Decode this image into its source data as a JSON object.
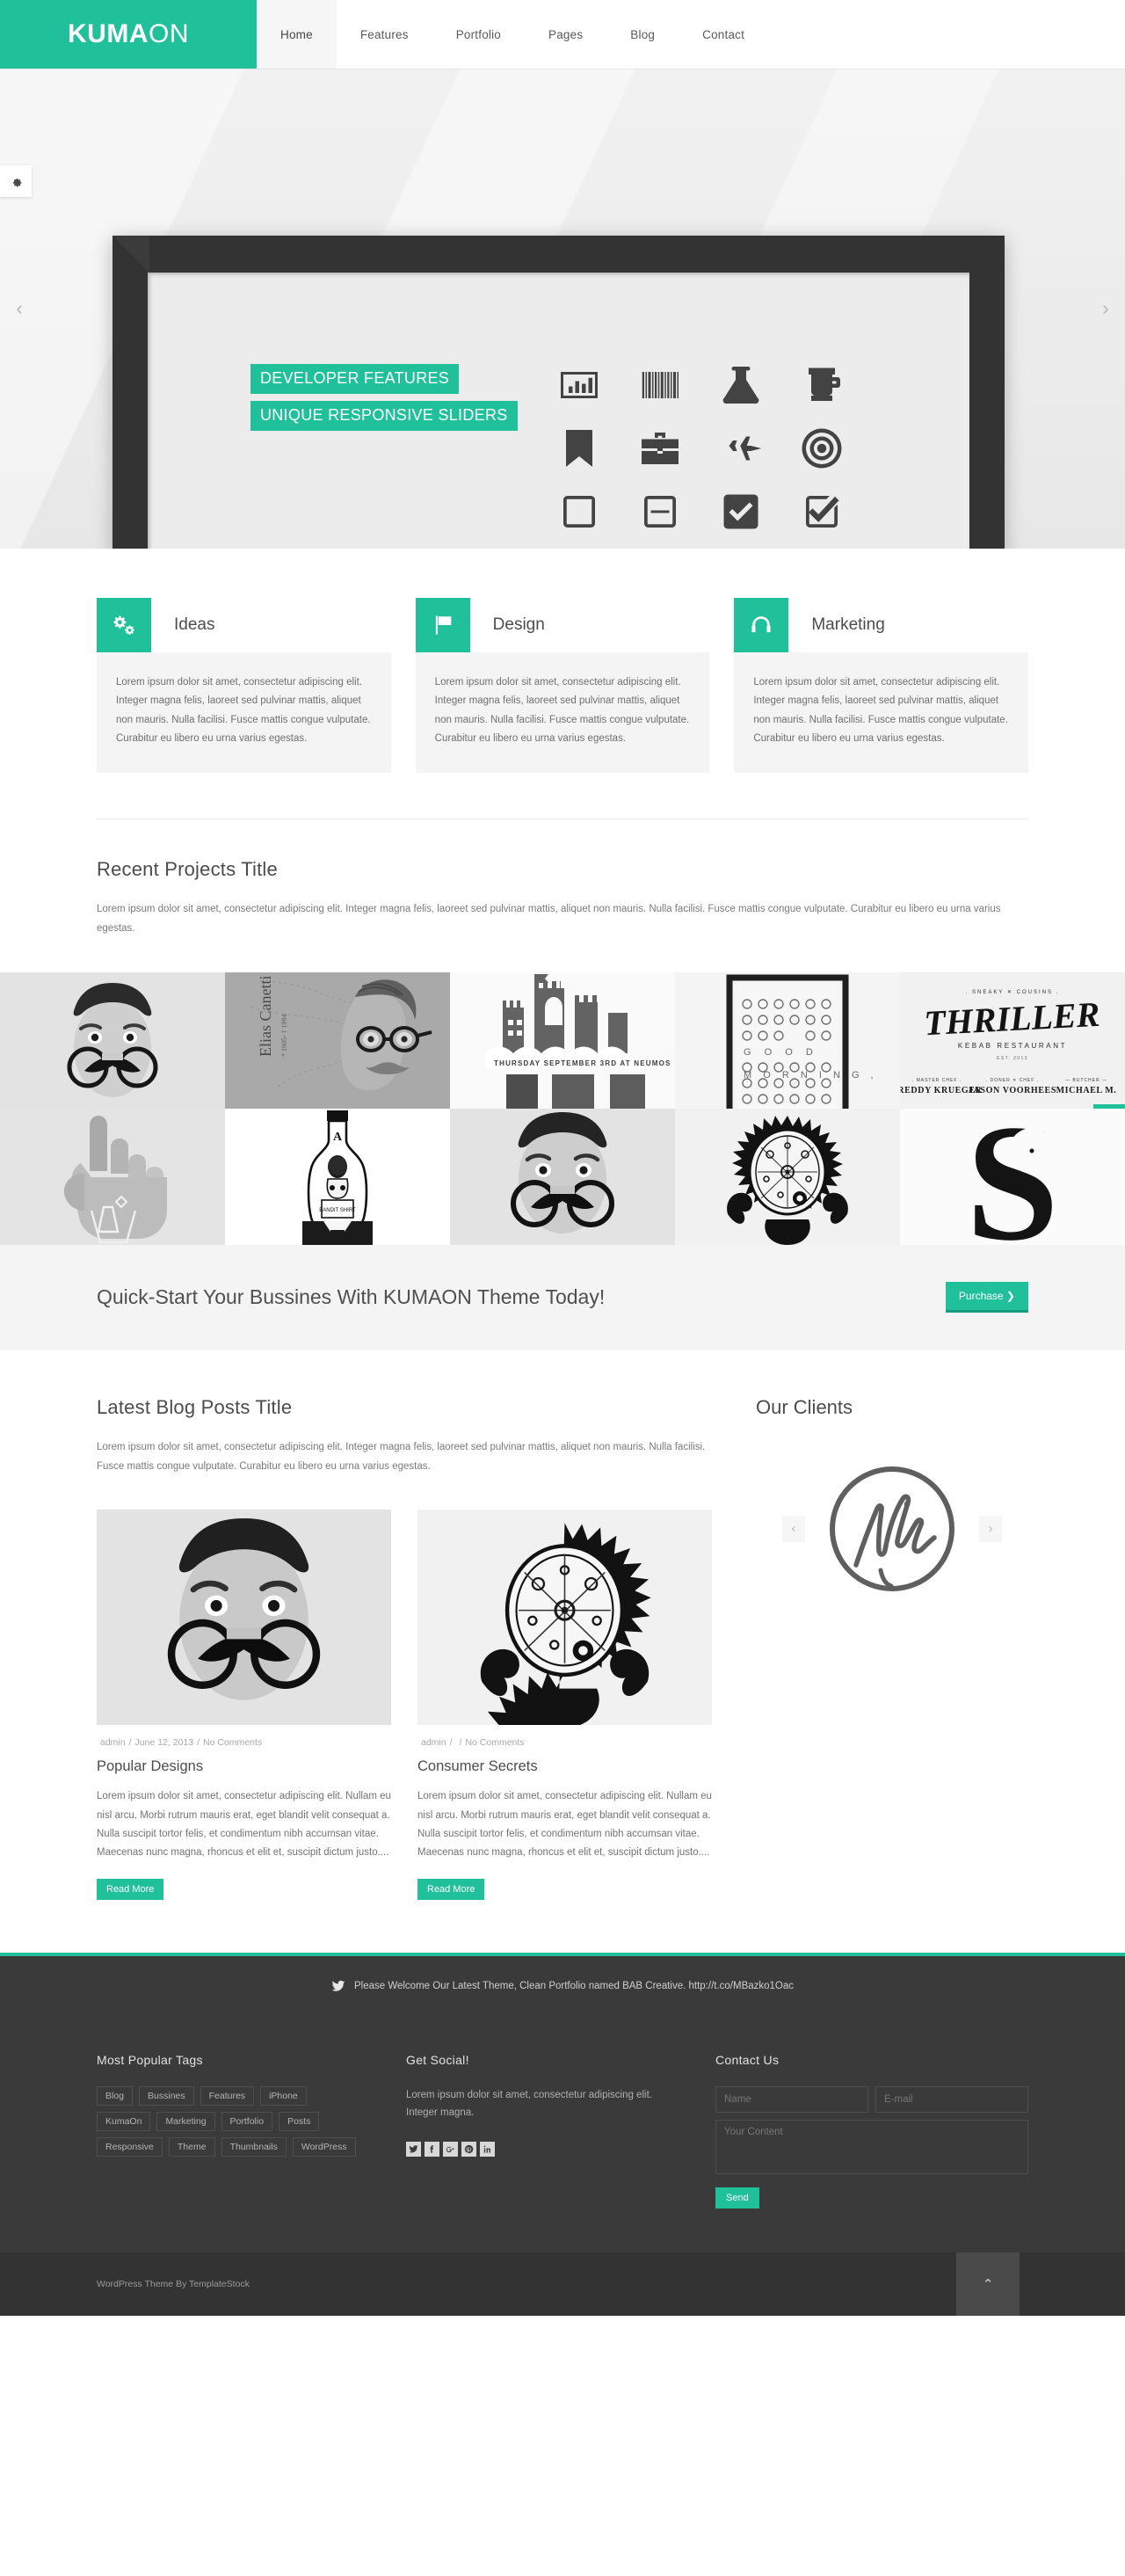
{
  "colors": {
    "accent": "#20c09b",
    "accent_dark": "#169b7c",
    "dark": "#3a3a3a",
    "frame": "#333333"
  },
  "header": {
    "brand_bold": "KUMA",
    "brand_light": "ON",
    "nav": [
      {
        "label": "Home",
        "active": true
      },
      {
        "label": "Features",
        "active": false
      },
      {
        "label": "Portfolio",
        "active": false
      },
      {
        "label": "Pages",
        "active": false
      },
      {
        "label": "Blog",
        "active": false
      },
      {
        "label": "Contact",
        "active": false
      }
    ]
  },
  "slider": {
    "settings_icon": "gear-icon",
    "prev_arrow": "‹",
    "next_arrow": "›",
    "tag_line_1": "DEVELOPER FEATURES",
    "tag_line_2": "UNIQUE RESPONSIVE SLIDERS",
    "icons": [
      "bar-chart-icon",
      "barcode-icon",
      "flask-icon",
      "blender-icon",
      "bookmark-icon",
      "briefcase-icon",
      "jet-icon",
      "bullseye-icon",
      "square-icon",
      "minus-square-icon",
      "check-square-filled-icon",
      "check-square-icon"
    ],
    "dots": [
      "active",
      "inactive"
    ]
  },
  "features": [
    {
      "icon": "gears-icon",
      "title": "Ideas",
      "text": "Lorem ipsum dolor sit amet, consectetur adipiscing elit. Integer magna felis, laoreet sed pulvinar mattis, aliquet non mauris. Nulla facilisi. Fusce mattis congue vulputate. Curabitur eu libero eu urna varius egestas."
    },
    {
      "icon": "flag-icon",
      "title": "Design",
      "text": "Lorem ipsum dolor sit amet, consectetur adipiscing elit. Integer magna felis, laoreet sed pulvinar mattis, aliquet non mauris. Nulla facilisi. Fusce mattis congue vulputate. Curabitur eu libero eu urna varius egestas."
    },
    {
      "icon": "headphones-icon",
      "title": "Marketing",
      "text": "Lorem ipsum dolor sit amet, consectetur adipiscing elit. Integer magna felis, laoreet sed pulvinar mattis, aliquet non mauris. Nulla facilisi. Fusce mattis congue vulputate. Curabitur eu libero eu urna varius egestas."
    }
  ],
  "projects": {
    "title": "Recent Projects Title",
    "text": "Lorem ipsum dolor sit amet, consectetur adipiscing elit. Integer magna felis, laoreet sed pulvinar mattis, aliquet non mauris. Nulla facilisi. Fusce mattis congue vulputate. Curabitur eu libero eu urna varius egestas.",
    "next_arrow": "›",
    "items": [
      {
        "name": "dali-portrait-monocle"
      },
      {
        "name": "elias-canetti-illustration",
        "caption": "Elias Canetti",
        "sub": "* 1905- † 1994"
      },
      {
        "name": "castle-gig-poster",
        "caption": "THURSDAY   SEPTEMBER 3RD   AT NEUMOS"
      },
      {
        "name": "good-morning-icon-poster",
        "caption": "G O O D",
        "sub": "M O R N I N G ,"
      },
      {
        "name": "thriller-kebab-logo",
        "caption": "THRILLER",
        "sub": "KEBAB RESTAURANT"
      },
      {
        "name": "hand-sign-photo"
      },
      {
        "name": "bottle-illustration"
      },
      {
        "name": "dali-portrait-monocle-2"
      },
      {
        "name": "mandala-ornament-print"
      },
      {
        "name": "letter-s-typography"
      }
    ]
  },
  "cta": {
    "title": "Quick-Start Your Bussines With KUMAON Theme Today!",
    "button": "Purchase ❯"
  },
  "blog": {
    "title": "Latest Blog Posts Title",
    "text": "Lorem ipsum dolor sit amet, consectetur adipiscing elit. Integer magna felis, laoreet sed pulvinar mattis, aliquet non mauris. Nulla facilisi. Fusce mattis congue vulputate. Curabitur eu libero eu urna varius egestas.",
    "posts": [
      {
        "thumb": "dali-portrait-monocle",
        "author": "admin",
        "date": "June 12, 2013",
        "comments": "No Comments",
        "title": "Popular Designs",
        "excerpt": "Lorem ipsum dolor sit amet, consectetur adipiscing elit. Nullam eu nisl arcu. Morbi rutrum mauris erat, eget blandit velit consequat a. Nulla suscipit tortor felis, et condimentum nibh accumsan vitae. Maecenas nunc magna, rhoncus et elit et, suscipit dictum justo....",
        "button": "Read More"
      },
      {
        "thumb": "mandala-ornament-print",
        "author": "admin",
        "date": "",
        "comments": "No Comments",
        "title": "Consumer Secrets",
        "excerpt": "Lorem ipsum dolor sit amet, consectetur adipiscing elit. Nullam eu nisl arcu. Morbi rutrum mauris erat, eget blandit velit consequat a. Nulla suscipit tortor felis, et condimentum nibh accumsan vitae. Maecenas nunc magna, rhoncus et elit et, suscipit dictum justo....",
        "button": "Read More"
      }
    ]
  },
  "clients": {
    "title": "Our Clients",
    "prev_arrow": "‹",
    "next_arrow": "›",
    "logo": "virgin-logo",
    "logo_text": "Virgin"
  },
  "tweet": {
    "icon": "twitter-icon",
    "text": "Please Welcome Our Latest Theme, Clean Portfolio named BAB Creative. http://t.co/MBazko1Oac"
  },
  "footer": {
    "tags_title": "Most Popular Tags",
    "tags": [
      "Blog",
      "Bussines",
      "Features",
      "iPhone",
      "KumaOn",
      "Marketing",
      "Portfolio",
      "Posts",
      "Responsive",
      "Theme",
      "Thumbnails",
      "WordPress"
    ],
    "social_title": "Get Social!",
    "social_text": "Lorem ipsum dolor sit amet, consectetur adipiscing elit. Integer magna.",
    "socials": [
      "twitter-icon",
      "facebook-icon",
      "googleplus-icon",
      "pinterest-icon",
      "linkedin-icon"
    ],
    "contact_title": "Contact Us",
    "name_placeholder": "Name",
    "email_placeholder": "E-mail",
    "content_placeholder": "Your Content",
    "send_label": "Send"
  },
  "bottom": {
    "copyright": "WordPress Theme By TemplateStock",
    "to_top_icon": "chevron-up-icon",
    "to_top_glyph": "⌃"
  }
}
